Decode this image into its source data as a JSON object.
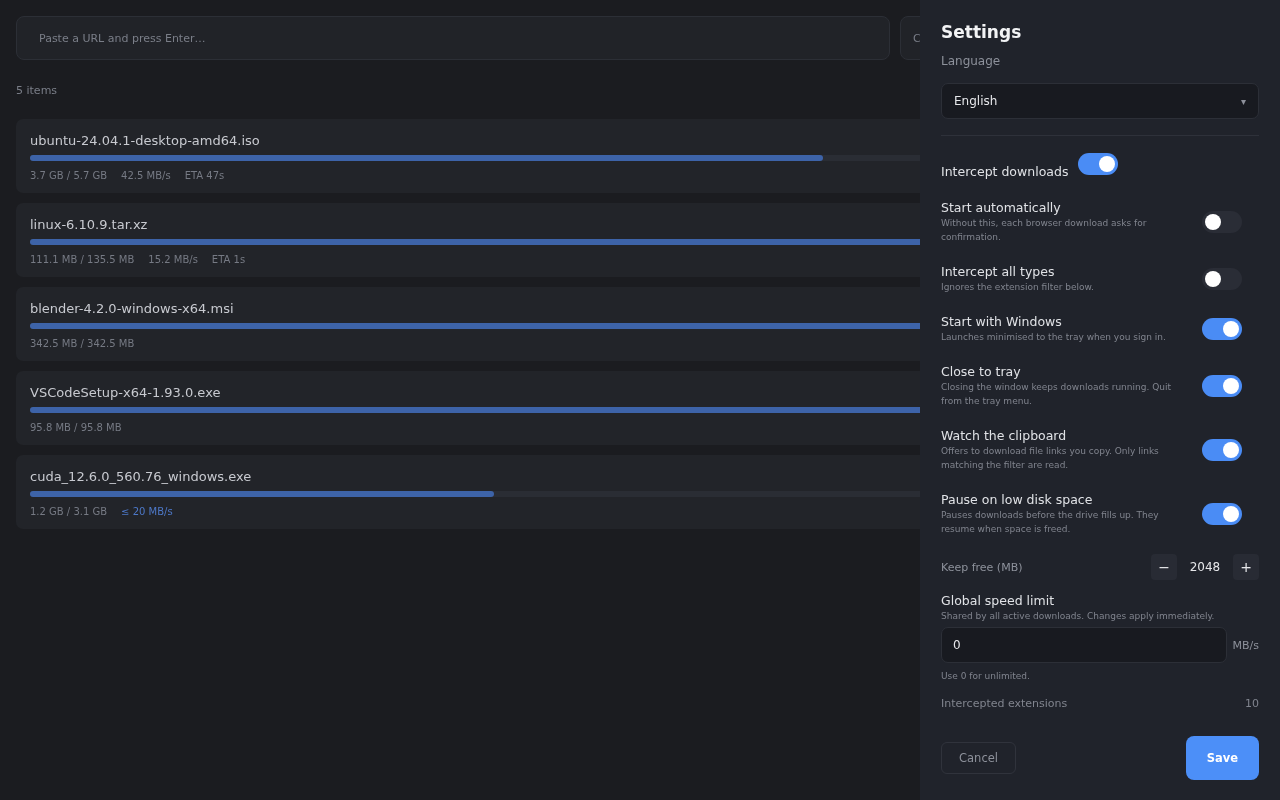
{
  "url_field": {
    "placeholder": "Paste a URL and press Enter…"
  },
  "side_button": {
    "label": "C"
  },
  "items_count": "5 items",
  "downloads": [
    {
      "name": "ubuntu-24.04.1-desktop-amd64.iso",
      "level": 0.65,
      "stats": [
        {
          "kind": "size",
          "text": "3.7 GB / 5.7 GB"
        },
        {
          "kind": "speed",
          "text": "42.5 MB/s"
        },
        {
          "kind": "eta",
          "text": "ETA 47s"
        }
      ]
    },
    {
      "name": "linux-6.10.9.tar.xz",
      "level": 0.82,
      "stats": [
        {
          "kind": "size",
          "text": "111.1 MB / 135.5 MB"
        },
        {
          "kind": "speed",
          "text": "15.2 MB/s"
        },
        {
          "kind": "eta",
          "text": "ETA 1s"
        }
      ]
    },
    {
      "name": "blender-4.2.0-windows-x64.msi",
      "level": 1,
      "stats": [
        {
          "kind": "size",
          "text": "342.5 MB / 342.5 MB"
        }
      ]
    },
    {
      "name": "VSCodeSetup-x64-1.93.0.exe",
      "level": 1,
      "stats": [
        {
          "kind": "size",
          "text": "95.8 MB / 95.8 MB"
        }
      ]
    },
    {
      "name": "cuda_12.6.0_560.76_windows.exe",
      "level": 0.38,
      "stats": [
        {
          "kind": "size",
          "text": "1.2 GB / 3.1 GB"
        },
        {
          "kind": "limit",
          "text": "≤ 20 MB/s"
        }
      ]
    }
  ],
  "settings": {
    "title": "Settings",
    "language": {
      "label": "Language",
      "value": "English",
      "caret": "▾"
    },
    "intercept": {
      "label": "Intercept downloads",
      "on": true
    },
    "toggles": [
      {
        "label": "Start automatically",
        "description": "Without this, each browser download asks for confirmation.",
        "on": false
      },
      {
        "label": "Intercept all types",
        "description": "Ignores the extension filter below.",
        "on": false
      },
      {
        "label": "Start with Windows",
        "description": "Launches minimised to the tray when you sign in.",
        "on": true
      },
      {
        "label": "Close to tray",
        "description": "Closing the window keeps downloads running. Quit from the tray menu.",
        "on": true
      },
      {
        "label": "Watch the clipboard",
        "description": "Offers to download file links you copy. Only links matching the filter are read.",
        "on": true
      },
      {
        "label": "Pause on low disk space",
        "description": "Pauses downloads before the drive fills up. They resume when space is freed.",
        "on": true
      }
    ],
    "keep_free": {
      "label": "Keep free (MB)",
      "minus": "−",
      "value": "2048",
      "plus": "+"
    },
    "speed_limit": {
      "label": "Global speed limit",
      "description": "Shared by all active downloads. Changes apply immediately.",
      "value": "0",
      "unit": "MB/s",
      "hint": "Use 0 for unlimited."
    },
    "extensions": {
      "label": "Intercepted extensions",
      "count": "10"
    },
    "buttons": {
      "cancel": "Cancel",
      "save": "Save"
    }
  }
}
